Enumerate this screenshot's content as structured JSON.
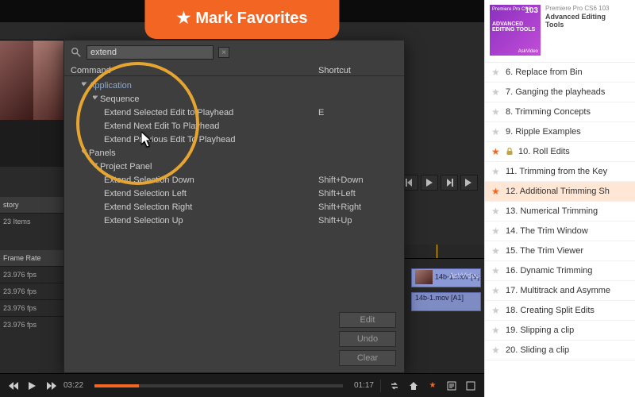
{
  "banner": {
    "text": "Mark Favorites",
    "star": "★"
  },
  "shortcut_panel": {
    "search_value": "extend",
    "headers": {
      "command": "Command",
      "shortcut": "Shortcut"
    },
    "groups": {
      "application": "Application",
      "sequence": "Sequence",
      "panels": "Panels",
      "project_panel": "Project Panel"
    },
    "rows": [
      {
        "cmd": "Extend Selected Edit to Playhead",
        "sc": "E"
      },
      {
        "cmd": "Extend Next Edit To Playhead",
        "sc": ""
      },
      {
        "cmd": "Extend Previous Edit To Playhead",
        "sc": ""
      }
    ],
    "panel_rows": [
      {
        "cmd": "Extend Selection Down",
        "sc": "Shift+Down"
      },
      {
        "cmd": "Extend Selection Left",
        "sc": "Shift+Left"
      },
      {
        "cmd": "Extend Selection Right",
        "sc": "Shift+Right"
      },
      {
        "cmd": "Extend Selection Up",
        "sc": "Shift+Up"
      }
    ],
    "buttons": {
      "edit": "Edit",
      "undo": "Undo",
      "clear": "Clear"
    }
  },
  "left_panel": {
    "story_label": "story",
    "item_count": "23 Items",
    "frame_rate_header": "Frame Rate",
    "fps_rows": [
      "23.976 fps",
      "23.976 fps",
      "23.976 fps",
      "23.976 fps"
    ]
  },
  "timeline": {
    "clip1": "14b-1.mov [V]  Opacity:O",
    "clip2": "14b-1.mov [A1]",
    "watermark": "AskVideo"
  },
  "player": {
    "current_time": "03:22",
    "total_time": "01:17"
  },
  "course": {
    "series": "Premiere Pro CS6",
    "code": "103",
    "thumb_line1": "ADVANCED",
    "thumb_line2": "EDITING TOOLS",
    "thumb_brand": "AskVideo",
    "title_line1": "Advanced Editing",
    "title_line2": "Tools"
  },
  "playlist": [
    {
      "n": "6",
      "title": "Replace from Bin",
      "fav": false,
      "locked": false,
      "active": false
    },
    {
      "n": "7",
      "title": "Ganging the playheads",
      "fav": false,
      "locked": false,
      "active": false
    },
    {
      "n": "8",
      "title": "Trimming Concepts",
      "fav": false,
      "locked": false,
      "active": false
    },
    {
      "n": "9",
      "title": "Ripple Examples",
      "fav": false,
      "locked": false,
      "active": false
    },
    {
      "n": "10",
      "title": "Roll Edits",
      "fav": true,
      "locked": true,
      "active": false
    },
    {
      "n": "11",
      "title": "Trimming from the Key",
      "fav": false,
      "locked": false,
      "active": false
    },
    {
      "n": "12",
      "title": "Additional Trimming Sh",
      "fav": true,
      "locked": false,
      "active": true
    },
    {
      "n": "13",
      "title": "Numerical Trimming",
      "fav": false,
      "locked": false,
      "active": false
    },
    {
      "n": "14",
      "title": "The Trim Window",
      "fav": false,
      "locked": false,
      "active": false
    },
    {
      "n": "15",
      "title": "The Trim Viewer",
      "fav": false,
      "locked": false,
      "active": false
    },
    {
      "n": "16",
      "title": "Dynamic Trimming",
      "fav": false,
      "locked": false,
      "active": false
    },
    {
      "n": "17",
      "title": "Multitrack and Asymme",
      "fav": false,
      "locked": false,
      "active": false
    },
    {
      "n": "18",
      "title": "Creating Split Edits",
      "fav": false,
      "locked": false,
      "active": false
    },
    {
      "n": "19",
      "title": "Slipping a clip",
      "fav": false,
      "locked": false,
      "active": false
    },
    {
      "n": "20",
      "title": "Sliding a clip",
      "fav": false,
      "locked": false,
      "active": false
    }
  ]
}
